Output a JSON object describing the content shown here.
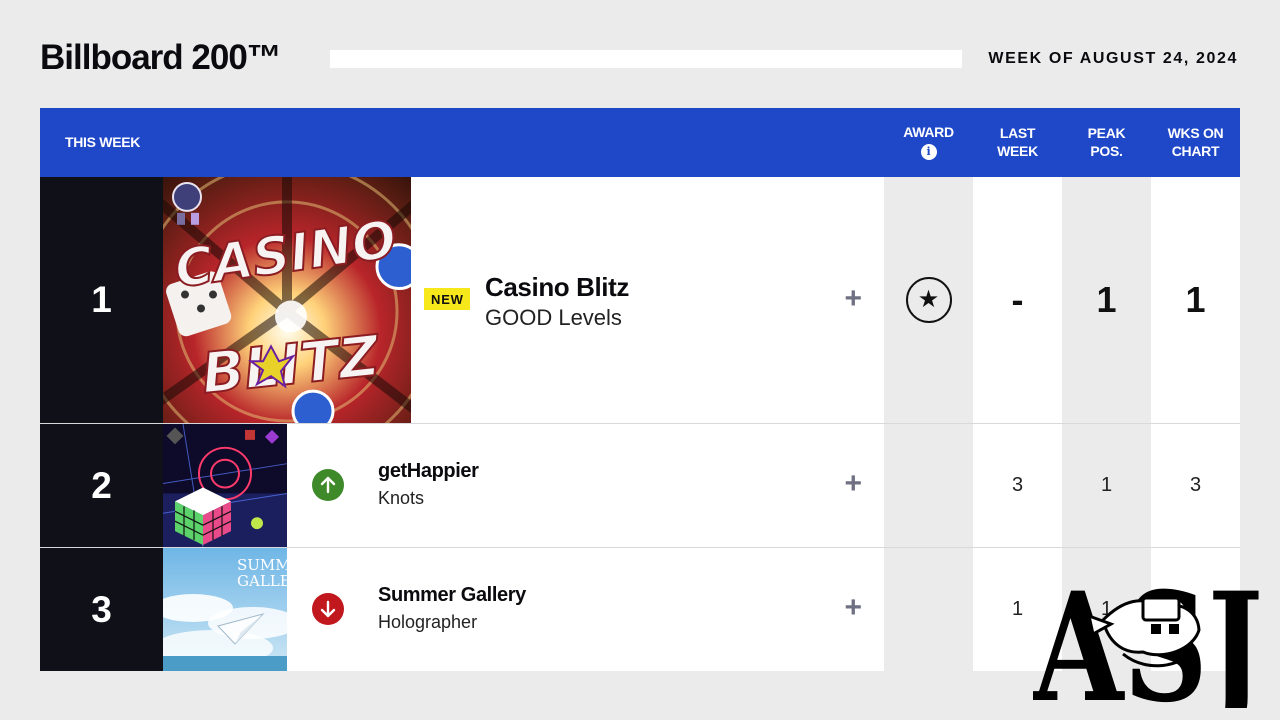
{
  "page": {
    "title": "Billboard 200™",
    "week": "WEEK OF AUGUST 24, 2024"
  },
  "header": {
    "this_week": "THIS WEEK",
    "award": "AWARD",
    "award_info_icon": "info-icon",
    "last_week_1": "LAST",
    "last_week_2": "WEEK",
    "peak_1": "PEAK",
    "peak_2": "POS.",
    "wks_1": "WKS ON",
    "wks_2": "CHART"
  },
  "entries": [
    {
      "rank": "1",
      "badge": "NEW",
      "title": "Casino Blitz",
      "artist": "GOOD Levels",
      "add_icon": "+",
      "award_icon": "★",
      "last_week": "-",
      "peak": "1",
      "weeks": "1"
    },
    {
      "rank": "2",
      "movement": "up",
      "title": "getHappier",
      "artist": "Knots",
      "add_icon": "+",
      "last_week": "3",
      "peak": "1",
      "weeks": "3"
    },
    {
      "rank": "3",
      "movement": "down",
      "title": "Summer Gallery",
      "artist": "Holographer",
      "add_icon": "+",
      "last_week": "1",
      "peak": "1",
      "weeks": ""
    }
  ],
  "album_art": {
    "casino_blitz_text_1": "CASINO",
    "casino_blitz_text_2": "BLITZ",
    "summer_gallery_text_1": "SUMM",
    "summer_gallery_text_2": "GALLE"
  },
  "watermark": {
    "text": "ASJ"
  },
  "colors": {
    "header_blue": "#1f48c8",
    "rank_bg": "#101118",
    "new_badge": "#f6e81b",
    "up_green": "#3e8a2a",
    "down_red": "#c1181e"
  }
}
